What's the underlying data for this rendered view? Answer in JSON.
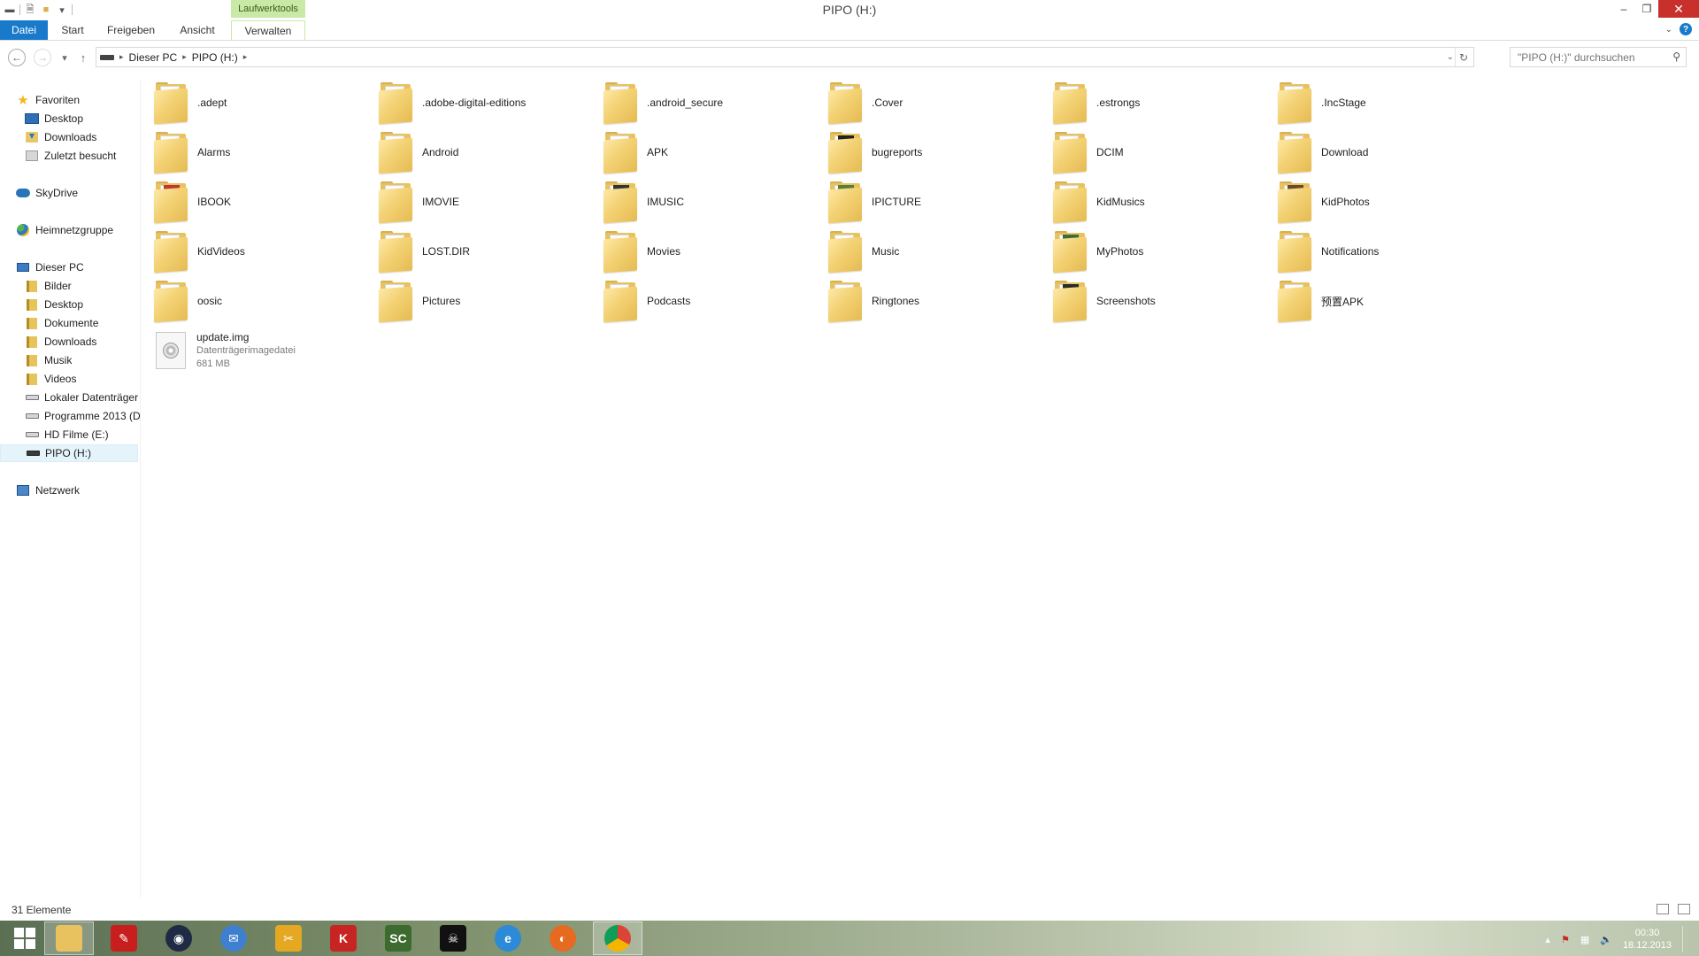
{
  "window": {
    "title": "PIPO (H:)",
    "context_tab_header": "Laufwerktools"
  },
  "ribbon": {
    "tabs": [
      {
        "label": "Datei"
      },
      {
        "label": "Start"
      },
      {
        "label": "Freigeben"
      },
      {
        "label": "Ansicht"
      },
      {
        "label": "Verwalten"
      }
    ]
  },
  "address": {
    "crumbs": [
      "Dieser PC",
      "PIPO (H:)"
    ],
    "search_placeholder": "\"PIPO (H:)\" durchsuchen"
  },
  "nav": {
    "items": [
      {
        "label": "Favoriten",
        "icon": "star-icon"
      },
      {
        "label": "Desktop",
        "icon": "desktop-icon"
      },
      {
        "label": "Downloads",
        "icon": "downloads-icon"
      },
      {
        "label": "Zuletzt besucht",
        "icon": "recent-places-icon"
      },
      {
        "label": "SkyDrive",
        "icon": "cloud-icon"
      },
      {
        "label": "Heimnetzgruppe",
        "icon": "homegroup-icon"
      },
      {
        "label": "Dieser PC",
        "icon": "computer-icon"
      },
      {
        "label": "Bilder",
        "icon": "library-icon"
      },
      {
        "label": "Desktop",
        "icon": "library-icon"
      },
      {
        "label": "Dokumente",
        "icon": "library-icon"
      },
      {
        "label": "Downloads",
        "icon": "library-icon"
      },
      {
        "label": "Musik",
        "icon": "library-icon"
      },
      {
        "label": "Videos",
        "icon": "library-icon"
      },
      {
        "label": "Lokaler Datenträger",
        "icon": "drive-icon"
      },
      {
        "label": "Programme 2013 (D",
        "icon": "drive-icon"
      },
      {
        "label": "HD Filme (E:)",
        "icon": "drive-icon"
      },
      {
        "label": "PIPO (H:)",
        "icon": "drive-icon"
      },
      {
        "label": "Netzwerk",
        "icon": "network-icon"
      }
    ]
  },
  "content": {
    "items": [
      {
        "name": ".adept"
      },
      {
        "name": ".adobe-digital-editions"
      },
      {
        "name": ".android_secure"
      },
      {
        "name": ".Cover"
      },
      {
        "name": ".estrongs"
      },
      {
        "name": ".IncStage"
      },
      {
        "name": "Alarms"
      },
      {
        "name": "Android"
      },
      {
        "name": "APK"
      },
      {
        "name": "bugreports"
      },
      {
        "name": "DCIM"
      },
      {
        "name": "Download"
      },
      {
        "name": "IBOOK"
      },
      {
        "name": "IMOVIE"
      },
      {
        "name": "IMUSIC"
      },
      {
        "name": "IPICTURE"
      },
      {
        "name": "KidMusics"
      },
      {
        "name": "KidPhotos"
      },
      {
        "name": "KidVideos"
      },
      {
        "name": "LOST.DIR"
      },
      {
        "name": "Movies"
      },
      {
        "name": "Music"
      },
      {
        "name": "MyPhotos"
      },
      {
        "name": "Notifications"
      },
      {
        "name": "oosic"
      },
      {
        "name": "Pictures"
      },
      {
        "name": "Podcasts"
      },
      {
        "name": "Ringtones"
      },
      {
        "name": "Screenshots"
      },
      {
        "name": "预置APK"
      }
    ],
    "file": {
      "name": "update.img",
      "type": "Datenträgerimagedatei",
      "size": "681 MB"
    }
  },
  "status": {
    "count": "31 Elemente"
  },
  "taskbar": {
    "sc_label": "SC",
    "time": "00:30",
    "date": "18.12.2013"
  }
}
